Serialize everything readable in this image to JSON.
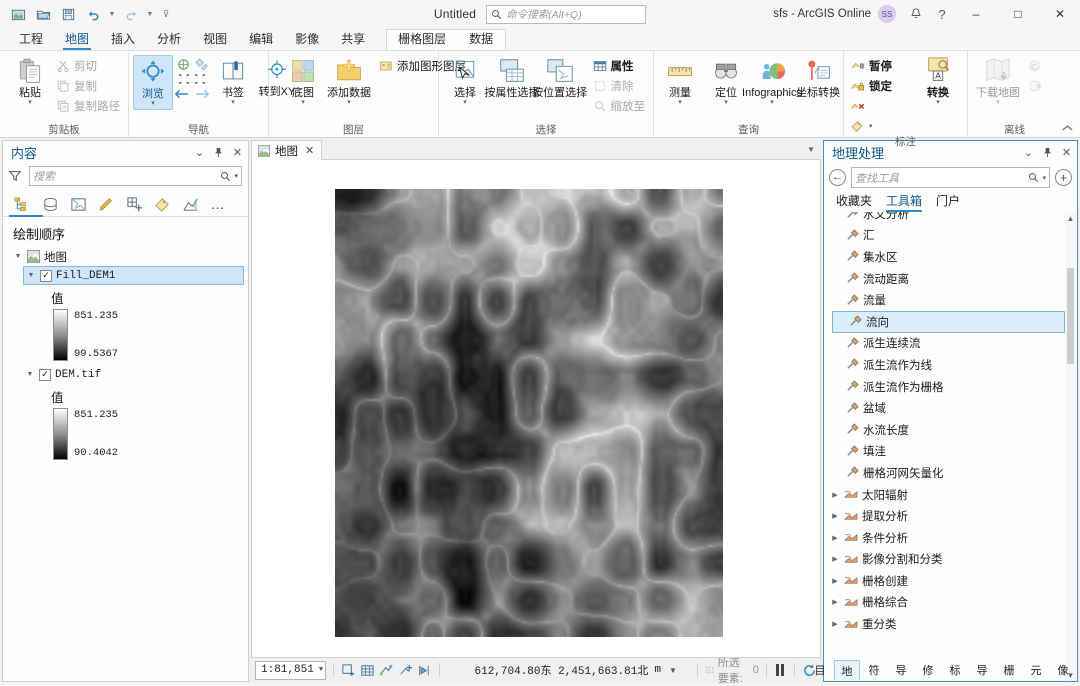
{
  "titlebar": {
    "quick_access": [
      {
        "name": "new-project-icon",
        "label": "新建工程"
      },
      {
        "name": "open-project-icon",
        "label": "打开工程"
      },
      {
        "name": "save-project-icon",
        "label": "保存工程"
      },
      {
        "name": "undo-icon",
        "label": "撤销"
      },
      {
        "name": "redo-icon",
        "label": "重做"
      },
      {
        "name": "customize-qat-icon",
        "label": "自定义快速访问工具栏"
      }
    ],
    "document_title": "Untitled",
    "search_placeholder": "命令搜索(Alt+Q)",
    "account_name": "sfs - ArcGIS Online",
    "avatar_initials": "SS",
    "notification_icon": "bell-icon",
    "help_icon": "question-icon",
    "window_controls": {
      "minimize": "–",
      "maximize": "□",
      "close": "✕"
    }
  },
  "ribbon_tabs": {
    "items": [
      {
        "label": "工程",
        "active": false
      },
      {
        "label": "地图",
        "active": true
      },
      {
        "label": "插入",
        "active": false
      },
      {
        "label": "分析",
        "active": false
      },
      {
        "label": "视图",
        "active": false
      },
      {
        "label": "编辑",
        "active": false
      },
      {
        "label": "影像",
        "active": false
      },
      {
        "label": "共享",
        "active": false
      }
    ],
    "contextual": [
      {
        "label": "栅格图层",
        "active": false
      },
      {
        "label": "数据",
        "active": false
      }
    ]
  },
  "ribbon": {
    "groups": [
      {
        "label": "剪贴板",
        "has_dialog_launcher": false,
        "big_buttons": [
          {
            "label": "粘贴",
            "icon": "paste-icon",
            "has_caret": true
          }
        ],
        "small_buttons": [
          {
            "label": "剪切",
            "icon": "cut-icon",
            "disabled": true
          },
          {
            "label": "复制",
            "icon": "copy-icon",
            "disabled": true
          },
          {
            "label": "复制路径",
            "icon": "copy-path-icon",
            "disabled": true
          }
        ]
      },
      {
        "label": "导航",
        "has_dialog_launcher": true,
        "big_buttons": [
          {
            "label": "浏览",
            "icon": "explore-icon",
            "has_caret": true,
            "selected": true
          },
          {
            "label": "书签",
            "icon": "bookmark-icon",
            "has_caret": true
          },
          {
            "label": "转到XY",
            "icon": "go-to-xy-icon",
            "has_caret": false
          }
        ],
        "mini_icons": [
          "full-extent-icon",
          "fixed-zoom-in-icon",
          "previous-extent-icon",
          "next-extent-icon"
        ]
      },
      {
        "label": "图层",
        "has_dialog_launcher": false,
        "big_buttons": [
          {
            "label": "底图",
            "icon": "basemap-icon",
            "has_caret": true
          },
          {
            "label": "添加数据",
            "icon": "add-data-icon",
            "has_caret": true
          }
        ],
        "small_buttons": [
          {
            "label": "添加图形图层",
            "icon": "add-graphics-layer-icon",
            "disabled": false
          }
        ]
      },
      {
        "label": "选择",
        "has_dialog_launcher": true,
        "big_buttons": [
          {
            "label": "选择",
            "icon": "select-icon",
            "has_caret": true
          },
          {
            "label": "按属性选择",
            "icon": "select-by-attributes-icon",
            "has_caret": false
          },
          {
            "label": "按位置选择",
            "icon": "select-by-location-icon",
            "has_caret": false
          }
        ],
        "small_buttons": [
          {
            "label": "属性",
            "icon": "attribute-table-icon",
            "disabled": false
          },
          {
            "label": "清除",
            "icon": "clear-selection-icon",
            "disabled": true
          },
          {
            "label": "缩放至",
            "icon": "zoom-to-selection-icon",
            "disabled": true
          }
        ]
      },
      {
        "label": "查询",
        "has_dialog_launcher": false,
        "big_buttons": [
          {
            "label": "测量",
            "icon": "measure-icon",
            "has_caret": true
          },
          {
            "label": "定位",
            "icon": "locate-icon",
            "has_caret": true
          },
          {
            "label": "Infographics",
            "icon": "infographics-icon",
            "has_caret": true
          },
          {
            "label": "坐标转换",
            "icon": "coordinate-conversion-icon",
            "has_caret": false
          }
        ]
      },
      {
        "label": "标注",
        "has_dialog_launcher": true,
        "big_buttons": [
          {
            "label": "转换",
            "icon": "convert-labels-icon",
            "has_caret": true
          }
        ],
        "small_buttons": [
          {
            "label": "暂停",
            "icon": "pause-labeling-icon",
            "disabled": false
          },
          {
            "label": "锁定",
            "icon": "lock-labels-icon",
            "disabled": false
          }
        ],
        "extra_icons": [
          "remove-labels-icon",
          "label-class-icon"
        ]
      },
      {
        "label": "离线",
        "has_dialog_launcher": true,
        "big_buttons": [
          {
            "label": "下载地图",
            "icon": "download-map-icon",
            "has_caret": true,
            "disabled": true
          }
        ],
        "small_buttons": [
          {
            "label": "",
            "icon": "sync-icon",
            "disabled": true
          },
          {
            "label": "",
            "icon": "remove-offline-icon",
            "disabled": true
          }
        ]
      }
    ],
    "collapse_icon": "chevron-up-icon"
  },
  "contents_pane": {
    "title": "内容",
    "header_buttons": [
      "menu-chevron-icon",
      "pin-icon",
      "close-icon"
    ],
    "search_placeholder": "搜索",
    "filter_icon": "filter-icon",
    "tabs": [
      {
        "name": "list-by-drawing-order-icon",
        "active": true
      },
      {
        "name": "list-by-data-source-icon",
        "active": false
      },
      {
        "name": "list-by-selection-icon",
        "active": false
      },
      {
        "name": "list-by-editing-icon",
        "active": false
      },
      {
        "name": "list-by-snapping-icon",
        "active": false
      },
      {
        "name": "list-by-labeling-icon",
        "active": false
      },
      {
        "name": "list-by-charts-icon",
        "active": false
      },
      {
        "name": "more-options-icon",
        "active": false
      }
    ],
    "section_title": "绘制顺序",
    "root": {
      "label": "地图",
      "icon": "map-icon"
    },
    "layers": [
      {
        "name": "Fill_DEM1",
        "checked": true,
        "selected": true,
        "legend_title": "值",
        "max": "851.235",
        "min": "99.5367"
      },
      {
        "name": "DEM.tif",
        "checked": true,
        "selected": false,
        "legend_title": "值",
        "max": "851.235",
        "min": "90.4042"
      }
    ]
  },
  "map_view": {
    "tab_label": "地图",
    "tab_icon": "map-icon",
    "close_icon": "close-icon",
    "overflow_icon": "chevron-down-icon"
  },
  "map_status": {
    "scale": "1:81,851",
    "tool_icons": [
      "full-extent-icon",
      "grid-icon",
      "snapping-icon",
      "add-vertex-icon",
      "measure-mode-icon"
    ],
    "coordinates": "612,704.80东  2,451,663.81北",
    "coordinate_units": "m",
    "units_caret": "chevron-down-icon",
    "selected_features_label": "所选要素:",
    "selected_features_count": "0",
    "pause_icon": "pause-drawing-icon",
    "refresh_icon": "refresh-icon"
  },
  "geoprocessing_pane": {
    "title": "地理处理",
    "header_buttons": [
      "menu-chevron-icon",
      "pin-icon",
      "close-icon"
    ],
    "back_icon": "back-arrow-icon",
    "search_placeholder": "查找工具",
    "search_icon": "search-icon",
    "dropdown_icon": "chevron-down-icon",
    "add_icon": "add-toolbox-icon",
    "tabs": [
      {
        "label": "收藏夹",
        "active": false
      },
      {
        "label": "工具箱",
        "active": true
      },
      {
        "label": "门户",
        "active": false
      }
    ],
    "items": [
      {
        "label": "水文分析",
        "type": "tool",
        "partial": true
      },
      {
        "label": "汇",
        "type": "tool"
      },
      {
        "label": "集水区",
        "type": "tool"
      },
      {
        "label": "流动距离",
        "type": "tool"
      },
      {
        "label": "流量",
        "type": "tool"
      },
      {
        "label": "流向",
        "type": "tool",
        "selected": true
      },
      {
        "label": "派生连续流",
        "type": "tool"
      },
      {
        "label": "派生流作为线",
        "type": "tool"
      },
      {
        "label": "派生流作为栅格",
        "type": "tool"
      },
      {
        "label": "盆域",
        "type": "tool"
      },
      {
        "label": "水流长度",
        "type": "tool"
      },
      {
        "label": "填洼",
        "type": "tool"
      },
      {
        "label": "栅格河网矢量化",
        "type": "tool"
      },
      {
        "label": "太阳辐射",
        "type": "toolset"
      },
      {
        "label": "提取分析",
        "type": "toolset"
      },
      {
        "label": "条件分析",
        "type": "toolset"
      },
      {
        "label": "影像分割和分类",
        "type": "toolset"
      },
      {
        "label": "栅格创建",
        "type": "toolset"
      },
      {
        "label": "栅格综合",
        "type": "toolset"
      },
      {
        "label": "重分类",
        "type": "toolset"
      }
    ]
  },
  "bottom_tabs": [
    {
      "label": "目",
      "active": false
    },
    {
      "label": "地",
      "active": true
    },
    {
      "label": "符",
      "active": false
    },
    {
      "label": "导",
      "active": false
    },
    {
      "label": "修",
      "active": false
    },
    {
      "label": "标",
      "active": false
    },
    {
      "label": "导",
      "active": false
    },
    {
      "label": "栅",
      "active": false
    },
    {
      "label": "元",
      "active": false
    },
    {
      "label": "像",
      "active": false
    }
  ],
  "colors": {
    "accent": "#2e8bc7",
    "accent_text": "#0a5a8c",
    "selection": "#cfe6fa",
    "pane_border": "#4a90c0"
  }
}
